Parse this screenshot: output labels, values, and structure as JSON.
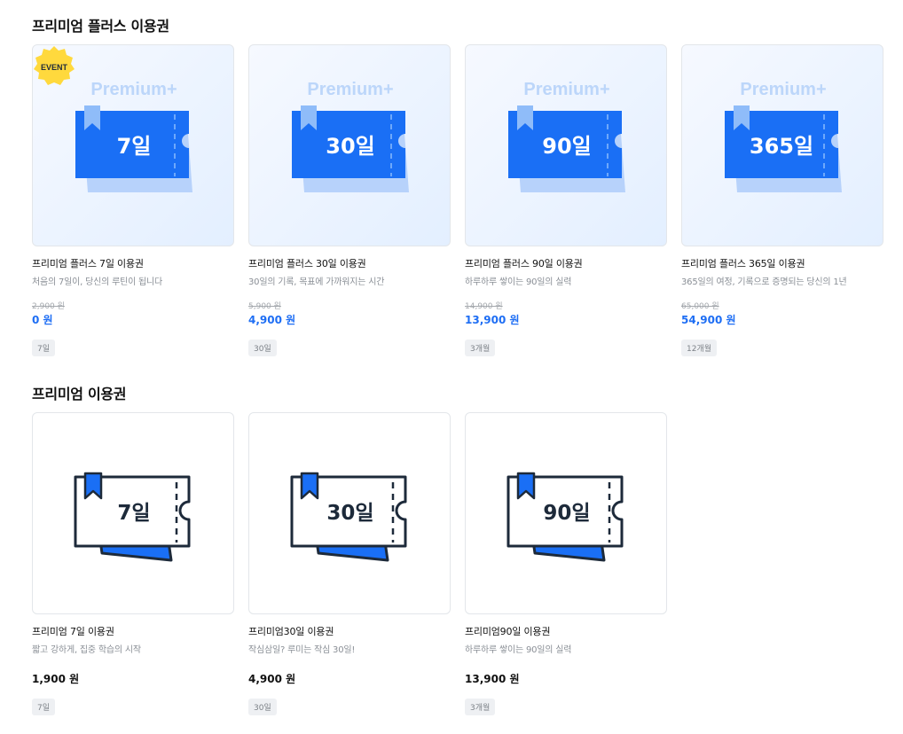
{
  "sections": {
    "plus_title": "프리미엄 플러스 이용권",
    "basic_title": "프리미엄 이용권"
  },
  "event_badge": "EVENT",
  "premium_plus_label": "Premium+",
  "plus_cards": [
    {
      "days": "7일",
      "title": "프리미엄 플러스 7일 이용권",
      "subtitle": "처음의 7일이, 당신의 루틴이 됩니다",
      "original_price": "2,900 원",
      "price": "0 원",
      "tag": "7일"
    },
    {
      "days": "30일",
      "title": "프리미엄 플러스 30일 이용권",
      "subtitle": "30일의 기록, 목표에 가까워지는 시간",
      "original_price": "5,900 원",
      "price": "4,900 원",
      "tag": "30일"
    },
    {
      "days": "90일",
      "title": "프리미엄 플러스 90일 이용권",
      "subtitle": "하루하루 쌓이는 90일의 실력",
      "original_price": "14,900 원",
      "price": "13,900 원",
      "tag": "3개월"
    },
    {
      "days": "365일",
      "title": "프리미엄 플러스 365일 이용권",
      "subtitle": "365일의 여정, 기록으로 증명되는 당신의 1년",
      "original_price": "65,000 원",
      "price": "54,900 원",
      "tag": "12개월"
    }
  ],
  "basic_cards": [
    {
      "days": "7일",
      "title": "프리미엄 7일 이용권",
      "subtitle": "짧고 강하게, 집중 학습의 시작",
      "price": "1,900 원",
      "tag": "7일"
    },
    {
      "days": "30일",
      "title": "프리미엄30일 이용권",
      "subtitle": "작심삼일? 루미는 작심 30일!",
      "price": "4,900 원",
      "tag": "30일"
    },
    {
      "days": "90일",
      "title": "프리미엄90일 이용권",
      "subtitle": "하루하루 쌓이는 90일의 실력",
      "price": "13,900 원",
      "tag": "3개월"
    }
  ],
  "colors": {
    "accent": "#1e6ef4",
    "ticket_blue": "#1a6ff5",
    "ticket_back": "#b7d2fb",
    "plus_label": "#bcd6fa",
    "dark_outline": "#1d2a3a",
    "event_yellow": "#ffd93d"
  }
}
